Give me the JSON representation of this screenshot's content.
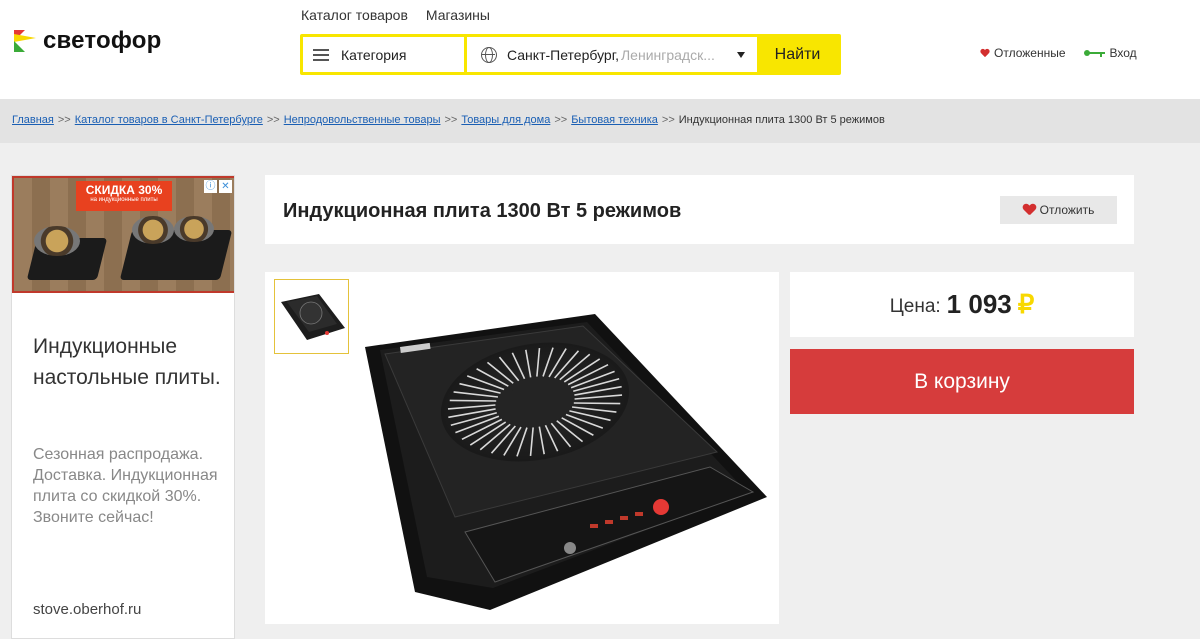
{
  "brand": {
    "name": "светофор",
    "colors": {
      "red": "#e53935",
      "yellow": "#f8d800",
      "green": "#3bab38"
    }
  },
  "topnav": {
    "catalog": "Каталог товаров",
    "stores": "Магазины"
  },
  "search": {
    "category_label": "Категория",
    "city": "Санкт-Петербург,",
    "region": "Ленинградск...",
    "find_label": "Найти"
  },
  "user": {
    "saved_label": "Отложенные",
    "login_label": "Вход"
  },
  "breadcrumbs": {
    "home": "Главная",
    "catalog": "Каталог товаров в Санкт-Петербурге",
    "nonfood": "Непродовольственные товары",
    "home_goods": "Товары для дома",
    "appliances": "Бытовая техника",
    "current": "Индукционная плита 1300 Вт 5 режимов",
    "separator": ">>"
  },
  "ad": {
    "badge_title": "СКИДКА 30%",
    "badge_sub": "на индукционные плиты",
    "title": "Индукционные настольные плиты.",
    "description": "Сезонная распродажа. Доставка. Индукционная плита со скидкой 30%. Звоните сейчас!",
    "url": "stove.oberhof.ru",
    "info_icon": "ⓘ",
    "close_icon": "✕"
  },
  "product": {
    "title": "Индукционная плита 1300 Вт 5 режимов",
    "defer_label": "Отложить",
    "price_label": "Цена:",
    "price": "1 093",
    "currency": "₽",
    "cart_label": "В корзину"
  }
}
